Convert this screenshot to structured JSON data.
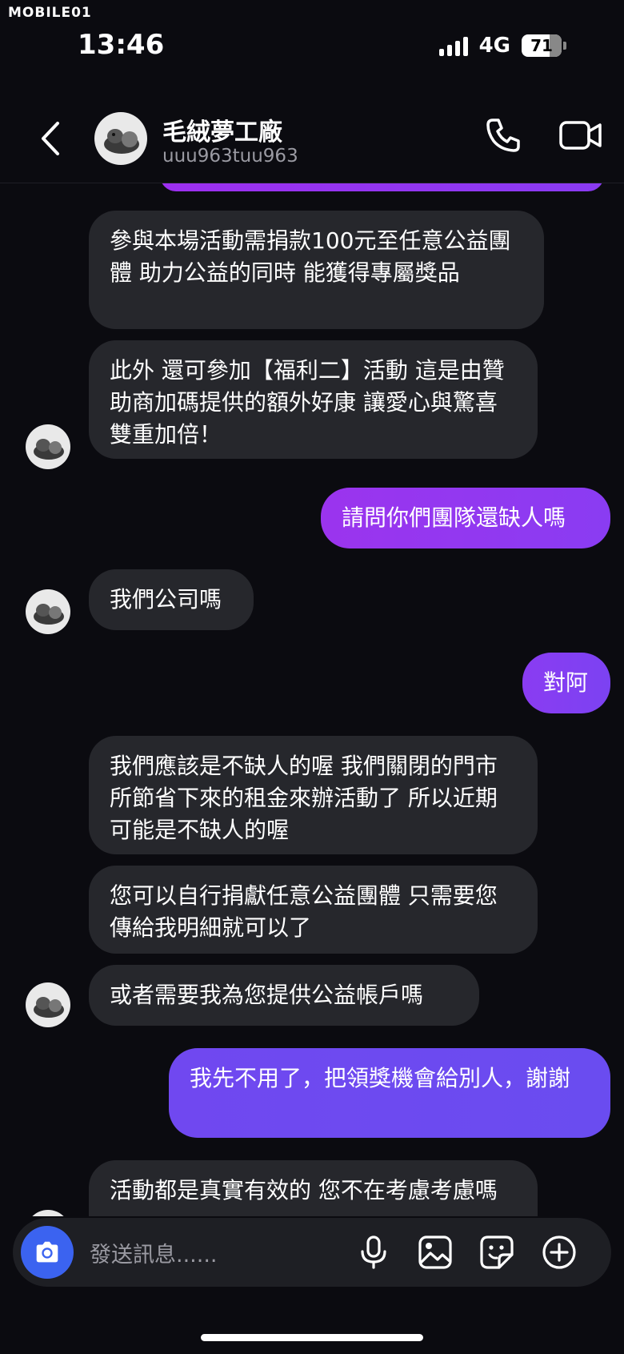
{
  "watermark": "MOBILE01",
  "status_bar": {
    "time": "13:46",
    "network": "4G",
    "battery": "71",
    "battery_level": 0.71
  },
  "header": {
    "title": "毛絨夢工廠",
    "subtitle": "uuu963tuu963"
  },
  "messages": [
    {
      "side": "in",
      "text": "參與本場活動需捐款100元至任意公益團體 助力公益的同時 能獲得專屬獎品"
    },
    {
      "side": "in",
      "text": "此外 還可參加【福利二】活動 這是由贊助商加碼提供的額外好康 讓愛心與驚喜雙重加倍！"
    },
    {
      "side": "out",
      "text": "請問你們團隊還缺人嗎"
    },
    {
      "side": "in",
      "text": "我們公司嗎"
    },
    {
      "side": "out",
      "text": "對阿"
    },
    {
      "side": "in",
      "text": "我們應該是不缺人的喔 我們關閉的門市所節省下來的租金來辦活動了 所以近期可能是不缺人的喔"
    },
    {
      "side": "in",
      "text": "您可以自行捐獻任意公益團體 只需要您傳給我明細就可以了"
    },
    {
      "side": "in",
      "text": "或者需要我為您提供公益帳戶嗎"
    },
    {
      "side": "out",
      "text": "我先不用了，把領獎機會給別人，謝謝"
    },
    {
      "side": "in",
      "text": "活動都是真實有效的 您不在考慮考慮嗎"
    }
  ],
  "composer": {
    "placeholder": "發送訊息......"
  },
  "icons": {
    "back": "chevron-left-icon",
    "call": "phone-icon",
    "video": "video-camera-icon",
    "camera": "camera-icon",
    "mic": "microphone-icon",
    "gallery": "image-icon",
    "sticker": "sticker-icon",
    "more": "plus-circle-icon"
  },
  "colors": {
    "background": "#0b0b10",
    "incoming": "#26272c",
    "outgoing": "#8a3cf2",
    "camera_button": "#3b63f0"
  }
}
